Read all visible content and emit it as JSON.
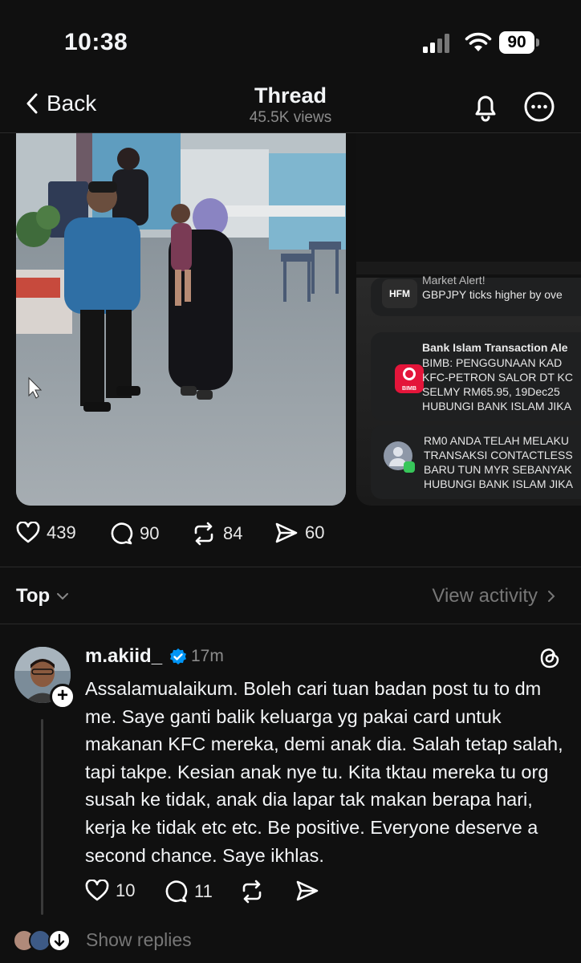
{
  "status_bar": {
    "time": "10:38",
    "battery": "90"
  },
  "nav": {
    "back_label": "Back",
    "title": "Thread",
    "views": "45.5K views"
  },
  "media_2": {
    "notifications": [
      {
        "title": "Market Alert!",
        "body": "GBPJPY ticks higher by ove"
      },
      {
        "title": "Bank Islam Transaction Ale",
        "lines": [
          "BIMB: PENGGUNAAN KAD",
          "KFC-PETRON SALOR DT KC",
          "SELMY RM65.95, 19Dec25",
          "HUBUNGI BANK ISLAM JIKA"
        ],
        "icon_label": "BIMB"
      },
      {
        "lines": [
          "RM0 ANDA TELAH MELAKU",
          "TRANSAKSI CONTACTLESS",
          "BARU TUN MYR SEBANYAK",
          "HUBUNGI BANK ISLAM JIKA"
        ]
      }
    ],
    "app_label": "HFM"
  },
  "post_actions": {
    "likes": "439",
    "comments": "90",
    "reposts": "84",
    "shares": "60"
  },
  "sort": {
    "label": "Top",
    "view_activity": "View activity"
  },
  "reply": {
    "username": "m.akiid_",
    "time": "17m",
    "text": "Assalamualaikum. Boleh cari tuan badan post tu to dm me. Saye ganti balik keluarga yg pakai card untuk makanan KFC mereka, demi anak dia. Salah tetap salah, tapi takpe. Kesian anak nye tu. Kita tktau mereka tu org susah ke tidak, anak dia lapar tak makan berapa hari, kerja ke tidak etc etc. Be positive. Everyone deserve a second chance. Saye ikhlas.",
    "likes": "10",
    "comments": "11"
  },
  "show_replies": "Show replies",
  "colors": {
    "background": "#101010",
    "text": "#f3f5f7",
    "muted": "#777777",
    "verified": "#0095f6",
    "bimb_red": "#e4153a"
  }
}
